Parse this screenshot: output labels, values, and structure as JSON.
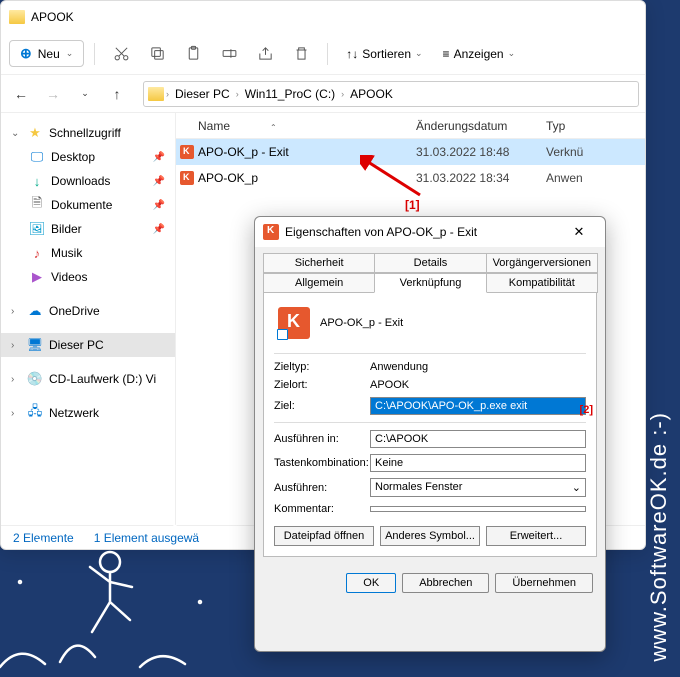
{
  "explorer": {
    "title": "APOOK",
    "new_label": "Neu",
    "sort_label": "Sortieren",
    "view_label": "Anzeigen",
    "breadcrumb": [
      "Dieser PC",
      "Win11_ProC (C:)",
      "APOOK"
    ],
    "columns": {
      "name": "Name",
      "date": "Änderungsdatum",
      "type": "Typ"
    },
    "rows": [
      {
        "name": "APO-OK_p - Exit",
        "date": "31.03.2022 18:48",
        "type": "Verknü"
      },
      {
        "name": "APO-OK_p",
        "date": "31.03.2022 18:34",
        "type": "Anwen"
      }
    ],
    "sidebar": {
      "quick": "Schnellzugriff",
      "items": [
        "Desktop",
        "Downloads",
        "Dokumente",
        "Bilder",
        "Musik",
        "Videos"
      ],
      "onedrive": "OneDrive",
      "thispc": "Dieser PC",
      "cd": "CD-Laufwerk (D:) Vi",
      "network": "Netzwerk"
    },
    "status": {
      "count": "2 Elemente",
      "sel": "1 Element ausgewä"
    }
  },
  "annotations": {
    "a1": "[1]",
    "a2": "[2]"
  },
  "props": {
    "title": "Eigenschaften von APO-OK_p - Exit",
    "tabs_top": [
      "Sicherheit",
      "Details",
      "Vorgängerversionen"
    ],
    "tabs_bot": [
      "Allgemein",
      "Verknüpfung",
      "Kompatibilität"
    ],
    "name": "APO-OK_p - Exit",
    "rows": {
      "zieltyp_l": "Zieltyp:",
      "zieltyp_v": "Anwendung",
      "zielort_l": "Zielort:",
      "zielort_v": "APOOK",
      "ziel_l": "Ziel:",
      "ziel_v": "C:\\APOOK\\APO-OK_p.exe exit",
      "ausf_l": "Ausführen in:",
      "ausf_v": "C:\\APOOK",
      "tasten_l": "Tastenkombination:",
      "tasten_v": "Keine",
      "ausf2_l": "Ausführen:",
      "ausf2_v": "Normales Fenster",
      "komm_l": "Kommentar:",
      "komm_v": ""
    },
    "btns": {
      "path": "Dateipfad öffnen",
      "icon": "Anderes Symbol...",
      "adv": "Erweitert..."
    },
    "dlg": {
      "ok": "OK",
      "cancel": "Abbrechen",
      "apply": "Übernehmen"
    }
  },
  "watermark": "www.SoftwareOK.de :-)"
}
